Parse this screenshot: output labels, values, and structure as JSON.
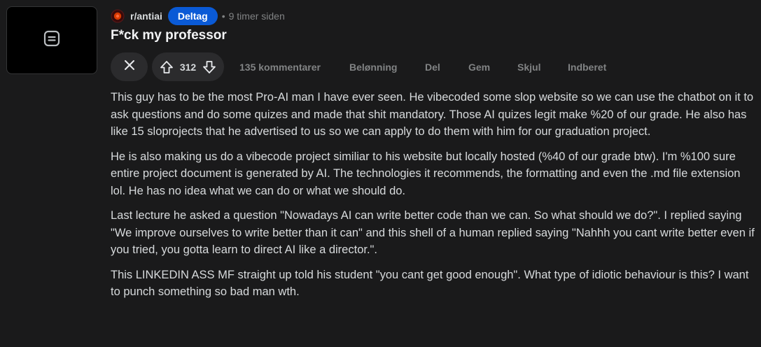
{
  "post": {
    "subreddit": "r/antiai",
    "join_label": "Deltag",
    "separator": "•",
    "time_ago": "9 timer siden",
    "title": "F*ck my professor",
    "thumbnail_icon": "text-post-icon",
    "subreddit_icon": "subreddit-icon"
  },
  "actions": {
    "close_icon": "close-icon",
    "upvote_icon": "upvote-arrow-icon",
    "downvote_icon": "downvote-arrow-icon",
    "vote_count": "312",
    "comments": "135 kommentarer",
    "award": "Belønning",
    "share": "Del",
    "save": "Gem",
    "hide": "Skjul",
    "report": "Indberet"
  },
  "body": {
    "paragraphs": [
      "This guy has to be the most Pro-AI man I have ever seen. He vibecoded some slop website so we can use the chatbot on it to ask questions and do some quizes and made that shit mandatory. Those AI quizes legit make %20 of our grade. He also has like 15 sloprojects that he advertised to us so we can apply to do them with him for our graduation project.",
      "He is also making us do a vibecode project similiar to his website but locally hosted (%40 of our grade btw). I'm %100 sure entire project document is generated by AI. The technologies it recommends, the formatting and even the .md file extension lol. He has no idea what we can do or what we should do.",
      "Last lecture he asked a question \"Nowadays AI can write better code than we can. So what should we do?\". I replied saying \"We improve ourselves to write better than it can\" and this shell of a human replied saying \"Nahhh you cant write better even if you tried, you gotta learn to direct AI like a director.\".",
      "This LINKEDIN ASS MF straight up told his student \"you cant get good enough\". What type of idiotic behaviour is this? I want to punch something so bad man wth."
    ]
  },
  "colors": {
    "background": "#1a1a1b",
    "thumbnail_bg": "#000000",
    "join_button": "#0a5ad6",
    "pill_bg": "#2b2b2d",
    "muted_text": "#818384",
    "body_text": "#d7dadc",
    "subreddit_icon_red": "#d93a00"
  }
}
